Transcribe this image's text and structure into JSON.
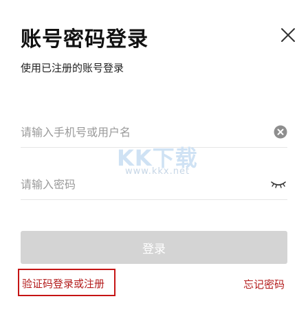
{
  "header": {
    "title": "账号密码登录",
    "subtitle": "使用已注册的账号登录",
    "close_icon": "close-icon"
  },
  "form": {
    "phone_placeholder": "请输入手机号或用户名",
    "phone_value": "",
    "password_placeholder": "请输入密码",
    "password_value": "",
    "clear_icon": "clear-circle-icon",
    "eye_icon": "eye-closed-icon"
  },
  "actions": {
    "login_label": "登录",
    "sms_login_label": "验证码登录或注册",
    "forgot_label": "忘记密码"
  },
  "watermark": {
    "logo": "KK下载",
    "url": "www.kkx.net"
  },
  "colors": {
    "accent_red": "#b31b1b",
    "highlight_border": "#c51414",
    "button_disabled": "#d4d4d4",
    "placeholder": "#9a9a9a"
  }
}
